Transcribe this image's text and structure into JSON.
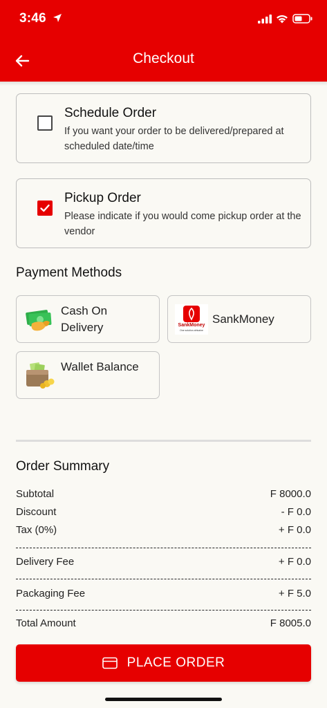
{
  "status_bar": {
    "time": "3:46"
  },
  "header": {
    "title": "Checkout",
    "back_icon": "arrow-left-icon"
  },
  "order_options": [
    {
      "title": "Schedule Order",
      "description": "If you want your order to be delivered/prepared at scheduled date/time",
      "checked": false
    },
    {
      "title": "Pickup Order",
      "description": "Please indicate if you would come pickup order at the vendor",
      "checked": true
    }
  ],
  "payment": {
    "title": "Payment Methods",
    "methods": [
      {
        "label": "Cash On Delivery",
        "icon": "cash-hand-icon"
      },
      {
        "label": "SankMoney",
        "icon": "sankmoney-logo",
        "logo_text": "SankMoney",
        "logo_tagline": "One solution africaine"
      },
      {
        "label": "Wallet Balance",
        "icon": "wallet-icon"
      }
    ]
  },
  "summary": {
    "title": "Order Summary",
    "subtotal": {
      "label": "Subtotal",
      "value": "F 8000.0"
    },
    "discount": {
      "label": "Discount",
      "value": "- F 0.0"
    },
    "tax": {
      "label": "Tax (0%)",
      "value": "+  F 0.0"
    },
    "delivery": {
      "label": "Delivery Fee",
      "value": "+ F 0.0"
    },
    "packaging": {
      "label": "Packaging Fee",
      "value": "+  F 5.0"
    },
    "total": {
      "label": "Total Amount",
      "value": "F 8005.0"
    }
  },
  "place_order": {
    "label": "PLACE ORDER",
    "icon": "credit-card-icon"
  },
  "colors": {
    "brand": "#E60000",
    "background": "#FAF9F4",
    "border": "#BDBDBD"
  }
}
